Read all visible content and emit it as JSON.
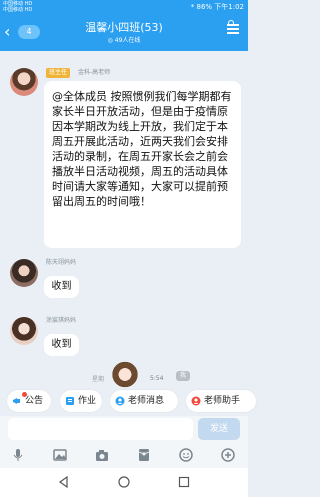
{
  "status_bar": {
    "carrier_line1": "中国移动 HD",
    "carrier_line2": "中国移动 HD",
    "time_right": "* 86% 下午1:02"
  },
  "header": {
    "back_icon": "chevron-left-icon",
    "unread_count": "4",
    "title": "温馨小四班(53)",
    "subtitle": "49人在线",
    "menu_icon": "group-menu-icon"
  },
  "messages": [
    {
      "role_badge": "班主任",
      "sender": "金科-高老师",
      "text": "@全体成员 按照惯例我们每学期都有家长半日开放活动，但是由于疫情原因本学期改为线上开放，我们定于本周五开展此活动，近两天我们会安排活动的录制，在周五开家长会之前会播放半日活动视频，周五的活动具体时间请大家等通知，大家可以提前预留出周五的时间哦！"
    },
    {
      "sender": "陈天翊妈妈",
      "text": "收到"
    },
    {
      "sender": "涂宸琪妈妈",
      "text": "收到"
    }
  ],
  "timestamp_partial": "星期",
  "overlay": {
    "time": "5:54",
    "badge": "我"
  },
  "quick_actions": [
    {
      "label": "公告",
      "icon": "megaphone-icon",
      "has_dot": true
    },
    {
      "label": "作业",
      "icon": "notebook-icon",
      "has_dot": false
    },
    {
      "label": "老师消息",
      "icon": "teacher-icon",
      "has_dot": false
    },
    {
      "label": "老师助手",
      "icon": "assistant-icon",
      "has_dot": false
    }
  ],
  "composer": {
    "placeholder": "",
    "send_label": "发送"
  },
  "toolbar": [
    "microphone-icon",
    "image-icon",
    "camera-icon",
    "red-packet-icon",
    "emoji-icon",
    "plus-icon"
  ],
  "colors": {
    "brand": "#2b9ff0",
    "badge": "#f1b43a",
    "dot": "#f0483c"
  }
}
